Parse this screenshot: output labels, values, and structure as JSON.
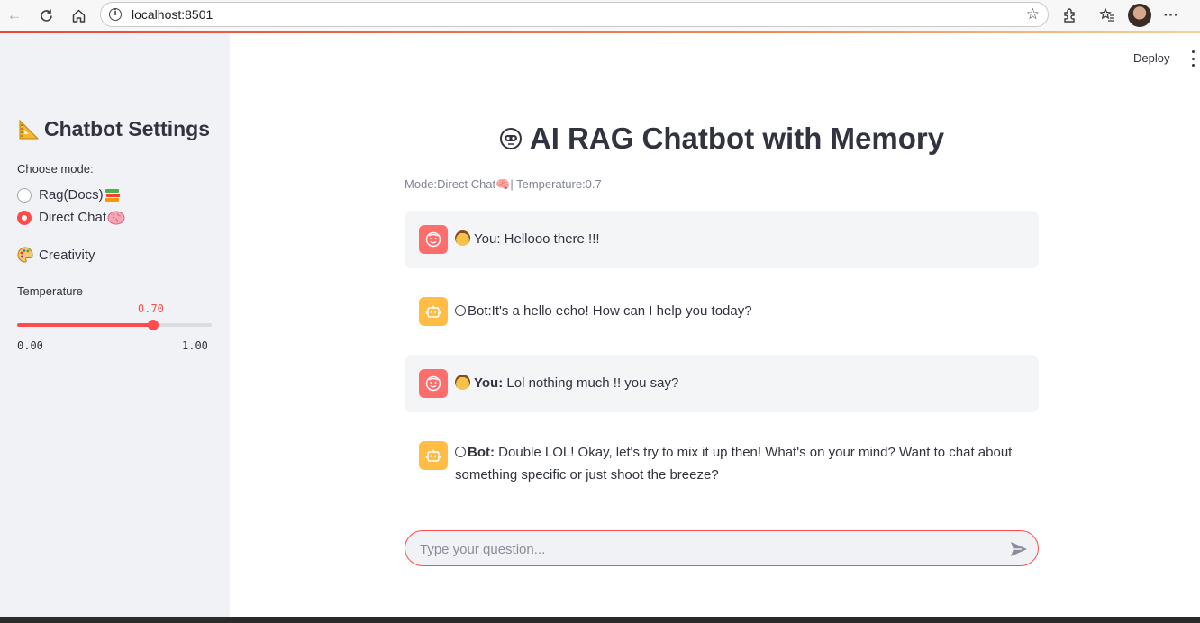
{
  "browser": {
    "url": "localhost:8501"
  },
  "sidebar": {
    "title": "Chatbot Settings",
    "title_icon": "triangle-ruler-icon",
    "mode_label": "Choose mode:",
    "modes": [
      {
        "label": "Rag(Docs)",
        "icon": "books-icon",
        "selected": false
      },
      {
        "label": "Direct Chat",
        "icon": "brain-icon",
        "selected": true
      }
    ],
    "creativity_label": "Creativity",
    "creativity_icon": "palette-icon",
    "temperature": {
      "label": "Temperature",
      "value_text": "0.70",
      "value": 0.7,
      "min_text": "0.00",
      "max_text": "1.00"
    }
  },
  "header": {
    "deploy_label": "Deploy"
  },
  "main": {
    "title": "AI RAG Chatbot with Memory",
    "title_icon": "robot-face-icon",
    "caption": "Mode:Direct Chat🧠| Temperature:0.7",
    "messages": [
      {
        "role": "user",
        "text": "You: Hellooo there !!!"
      },
      {
        "role": "bot",
        "text": "Bot:It's a hello echo! How can I help you today?"
      },
      {
        "role": "user",
        "speaker": "You:",
        "text": "Lol nothing much !! you say?"
      },
      {
        "role": "bot",
        "speaker": "Bot:",
        "text": "Double LOL! Okay, let's try to mix it up then! What's on your mind? Want to chat about something specific or just shoot the breeze?"
      }
    ],
    "input": {
      "placeholder": "Type your question..."
    }
  },
  "colors": {
    "accent": "#ff4b4b",
    "sidebar_bg": "#f0f2f6",
    "user_avatar": "#ff6c6c",
    "bot_avatar": "#ffbd45"
  }
}
